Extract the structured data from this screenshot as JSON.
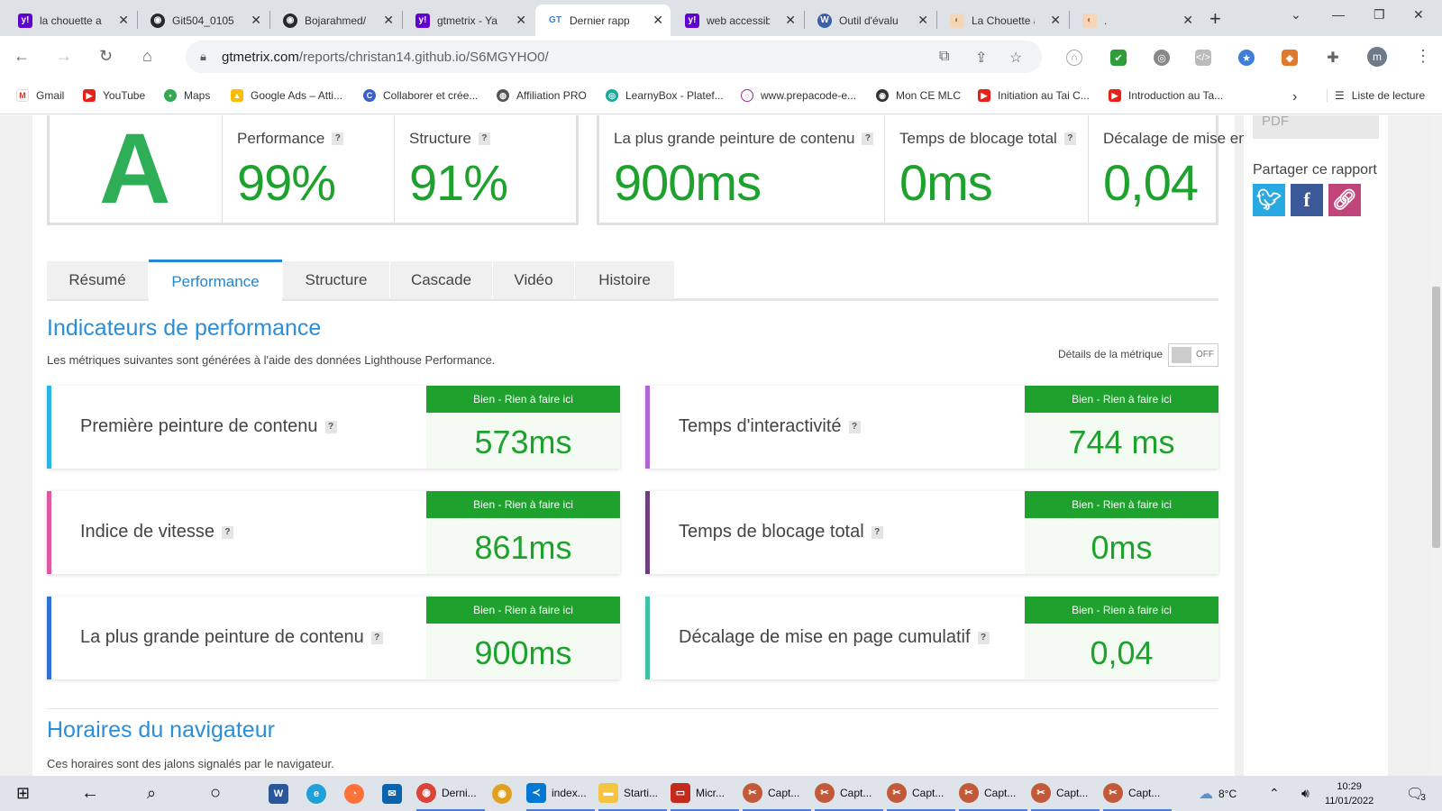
{
  "browser": {
    "tabs": [
      {
        "label": "la chouette a",
        "icon": "y!"
      },
      {
        "label": "Git504_0105",
        "icon": "gh"
      },
      {
        "label": "Bojarahmed/",
        "icon": "gh"
      },
      {
        "label": "gtmetrix - Ya",
        "icon": "y!"
      },
      {
        "label": "Dernier rapp",
        "icon": "GT"
      },
      {
        "label": "web accessib",
        "icon": "y!"
      },
      {
        "label": "Outil d'évalu",
        "icon": "W"
      },
      {
        "label": "La Chouette a",
        "icon": "owl"
      },
      {
        "label": ".",
        "icon": "owl"
      }
    ],
    "url_host": "gtmetrix.com",
    "url_path": "/reports/christan14.github.io/S6MGYHO0/",
    "profile_initial": "m"
  },
  "bookmarks": [
    {
      "label": "Gmail"
    },
    {
      "label": "YouTube"
    },
    {
      "label": "Maps"
    },
    {
      "label": "Google Ads – Atti..."
    },
    {
      "label": "Collaborer et crée..."
    },
    {
      "label": "Affiliation PRO"
    },
    {
      "label": "LearnyBox - Platef..."
    },
    {
      "label": "www.prepacode-e..."
    },
    {
      "label": "Mon CE MLC"
    },
    {
      "label": "Initiation au Tai C..."
    },
    {
      "label": "Introduction au Ta..."
    }
  ],
  "reading_list": "Liste de lecture",
  "summary": {
    "grade": "A",
    "performance_label": "Performance",
    "performance_value": "99%",
    "structure_label": "Structure",
    "structure_value": "91%",
    "lcp_label": "La plus grande peinture de contenu",
    "lcp_value": "900ms",
    "tbt_label": "Temps de blocage total",
    "tbt_value": "0ms",
    "cls_label": "Décalage de mise en page cumulatif",
    "cls_value": "0,04",
    "help": "?"
  },
  "page_tabs": [
    "Résumé",
    "Performance",
    "Structure",
    "Cascade",
    "Vidéo",
    "Histoire"
  ],
  "section": {
    "title": "Indicateurs de performance",
    "description": "Les métriques suivantes sont générées à l'aide des données Lighthouse Performance.",
    "toggle_label": "Détails de la métrique",
    "toggle_state": "OFF"
  },
  "metrics": [
    {
      "label": "Première peinture de contenu",
      "status": "Bien - Rien à faire ici",
      "value": "573ms",
      "color": "#29b6e6"
    },
    {
      "label": "Temps d'interactivité",
      "status": "Bien - Rien à faire ici",
      "value": "744 ms",
      "color": "#b266d6"
    },
    {
      "label": "Indice de vitesse",
      "status": "Bien - Rien à faire ici",
      "value": "861ms",
      "color": "#e2589f"
    },
    {
      "label": "Temps de blocage total",
      "status": "Bien - Rien à faire ici",
      "value": "0ms",
      "color": "#6d3f7f"
    },
    {
      "label": "La plus grande peinture de contenu",
      "status": "Bien - Rien à faire ici",
      "value": "900ms",
      "color": "#2f6fd6"
    },
    {
      "label": "Décalage de mise en page cumulatif",
      "status": "Bien - Rien à faire ici",
      "value": "0,04",
      "color": "#3fc1a6"
    }
  ],
  "next_section": {
    "title": "Horaires du navigateur",
    "description": "Ces horaires sont des jalons signalés par le navigateur."
  },
  "sidebar": {
    "pdf_label": "PDF",
    "share_title": "Partager ce rapport"
  },
  "taskbar": {
    "items": [
      {
        "label": "Derni..."
      },
      {
        "label": "index..."
      },
      {
        "label": "Starti..."
      },
      {
        "label": "Micr..."
      },
      {
        "label": "Capt..."
      },
      {
        "label": "Capt..."
      },
      {
        "label": "Capt..."
      },
      {
        "label": "Capt..."
      },
      {
        "label": "Capt..."
      },
      {
        "label": "Capt..."
      }
    ],
    "temperature": "8°C",
    "time": "10:29",
    "date": "11/01/2022",
    "notifications": "3"
  },
  "colors": {
    "accent_blue": "#2a8ed8",
    "good_green": "#1fa12e",
    "grade_green": "#2eaf57"
  }
}
